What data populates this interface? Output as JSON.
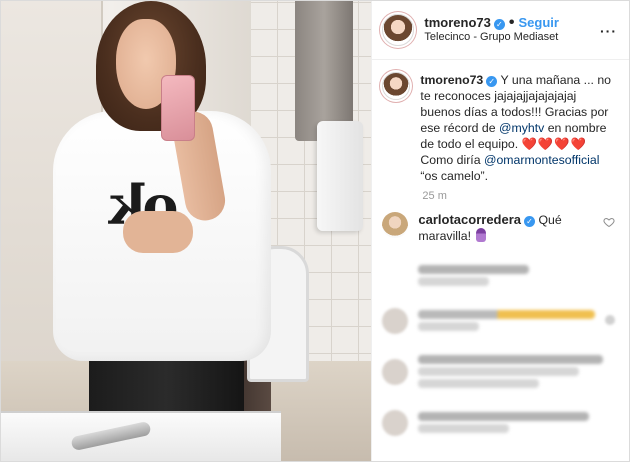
{
  "header": {
    "username": "tmoreno73",
    "follow_label": "Seguir",
    "separator": "•",
    "location": "Telecinco - Grupo Mediaset",
    "more_icon": "more-dots-icon"
  },
  "caption": {
    "username": "tmoreno73",
    "text_1": "Y una mañana ... no te reconoces jajajajjajajajajaj buenos días a todos!!! Gracias por ese récord de ",
    "mention_1": "@myhtv",
    "text_2": " en nombre de todo el equipo. ",
    "hearts": "❤️❤️❤️❤️",
    "text_3": " Como diría ",
    "mention_2": "@omarmontesofficial",
    "text_4": " “os camelo”.",
    "time": "25 m"
  },
  "comments": [
    {
      "username": "carlotacorredera",
      "text": "Qué maravilla!",
      "emoji_icon": "woman-emoji-icon",
      "heart_icon": "heart-outline-icon"
    }
  ],
  "colors": {
    "accent": "#3897f0",
    "text": "#262626",
    "secondary": "#999999",
    "mention": "#003569",
    "border": "#dbdbdb"
  }
}
